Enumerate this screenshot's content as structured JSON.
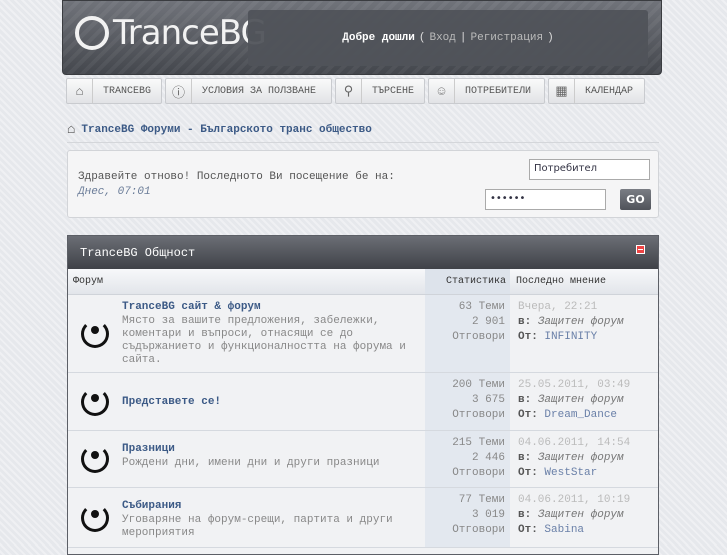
{
  "header": {
    "logo": "TranceBG",
    "welcome": "Добре дошли",
    "login": "Вход",
    "register": "Регистрация"
  },
  "nav": [
    {
      "label": "TRANCEBG",
      "icon": "home-icon"
    },
    {
      "label": "УСЛОВИЯ ЗА ПОЛЗВАНЕ",
      "icon": "info-icon"
    },
    {
      "label": "ТЪРСЕНЕ",
      "icon": "search-icon"
    },
    {
      "label": "ПОТРЕБИТЕЛИ",
      "icon": "user-icon"
    },
    {
      "label": "КАЛЕНДАР",
      "icon": "calendar-icon"
    }
  ],
  "breadcrumb": "TranceBG Форуми - Българското транс общество",
  "login": {
    "greeting": "Здравейте отново! Последното Ви посещение бе на:",
    "last_visit": "Днес, 07:01",
    "username": "Потребител",
    "password": "••••••",
    "go": "GO"
  },
  "category": {
    "title": "TranceBG Общност",
    "col_forum": "Форум",
    "col_stats": "Статистика",
    "col_last": "Последно мнение"
  },
  "forums": [
    {
      "title": "TranceBG сайт & форум",
      "desc": "Място за вашите предложения, забележки, коментари и въпроси, отнасящи се до съдържанието и функционалността на форума и сайта.",
      "topics": "63 Теми",
      "replies": "2 901",
      "replies_label": "Отговори",
      "date": "Вчера, 22:21",
      "in_label": "в:",
      "in": "Защитен форум",
      "by_label": "От:",
      "by": "INFINITY"
    },
    {
      "title": "Представете се!",
      "desc": "",
      "topics": "200 Теми",
      "replies": "3 675",
      "replies_label": "Отговори",
      "date": "25.05.2011, 03:49",
      "in_label": "в:",
      "in": "Защитен форум",
      "by_label": "От:",
      "by": "Dream_Dance"
    },
    {
      "title": "Празници",
      "desc": "Рождени дни, имени дни и други празници",
      "topics": "215 Теми",
      "replies": "2 446",
      "replies_label": "Отговори",
      "date": "04.06.2011, 14:54",
      "in_label": "в:",
      "in": "Защитен форум",
      "by_label": "От:",
      "by": "WestStar"
    },
    {
      "title": "Събирания",
      "desc": "Уговаряне на форум-срещи, партита и други мероприятия",
      "topics": "77 Теми",
      "replies": "3 019",
      "replies_label": "Отговори",
      "date": "04.06.2011, 10:19",
      "in_label": "в:",
      "in": "Защитен форум",
      "by_label": "От:",
      "by": "Sabina"
    }
  ]
}
